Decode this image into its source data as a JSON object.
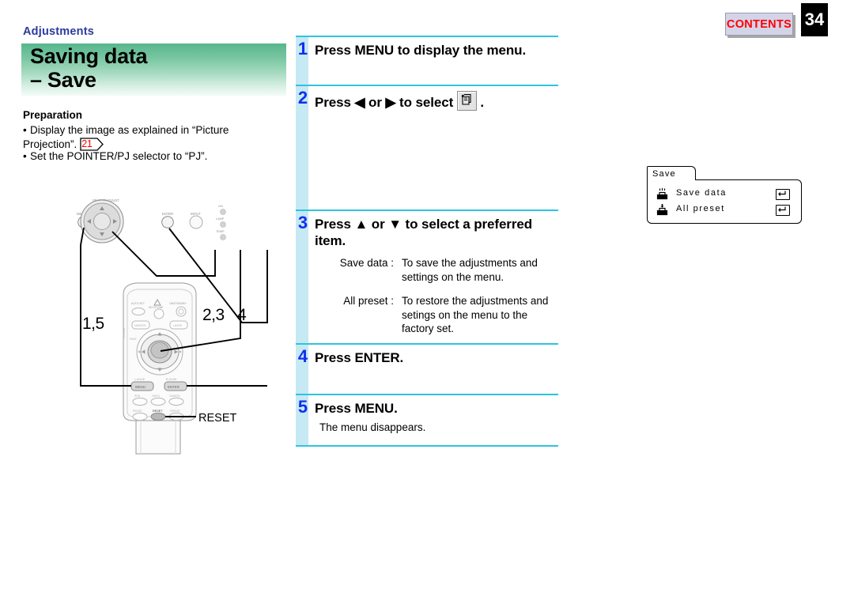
{
  "header": {
    "contents_label": "CONTENTS",
    "page_number": "34",
    "section_label": "Adjustments"
  },
  "title": {
    "line1": "Saving data",
    "line2": "– Save"
  },
  "preparation": {
    "heading": "Preparation",
    "items": [
      "Display the image as explained in “Picture Projection”.",
      "Set the POINTER/PJ selector to “PJ”."
    ],
    "page_ref": "21"
  },
  "steps": [
    {
      "number": "1",
      "heading": "Press MENU to display the menu."
    },
    {
      "number": "2",
      "heading_before": "Press ◀ or ▶ to select",
      "heading_after": ".",
      "icon": "save-menu-icon"
    },
    {
      "number": "3",
      "heading": "Press ▲ or ▼ to select a preferred item.",
      "definitions": [
        {
          "term": "Save data :",
          "desc": "To save the adjustments and settings on the menu."
        },
        {
          "term": "All preset :",
          "desc": "To restore the adjustments and setings on the menu to the factory set."
        }
      ]
    },
    {
      "number": "4",
      "heading": "Press ENTER."
    },
    {
      "number": "5",
      "heading": "Press MENU.",
      "note": "The menu disappears."
    }
  ],
  "osd_menu": {
    "tab_label": "Save",
    "rows": [
      {
        "label": "Save data",
        "icon": "save-data-icon",
        "action": "enter-return-icon"
      },
      {
        "label": "All preset",
        "icon": "all-preset-icon",
        "action": "enter-return-icon"
      }
    ]
  },
  "illustration": {
    "projector_panel": {
      "labels": [
        "ON/STANDBY",
        "MENU",
        "SELECT/ADJUST",
        "ENTER",
        "INPUT",
        "ON",
        "LAMP",
        "TEMP"
      ]
    },
    "remote": {
      "labels": [
        "AUTO SET",
        "KEYSTONE",
        "ON/STANDBY",
        "MARKER",
        "LASER",
        "VOLUME",
        "FREEZE",
        "L-CLICK",
        "MENU",
        "R-CLICK",
        "ENTER",
        "RGB",
        "VIDEO",
        "CAMERA",
        "RESIZE",
        "RESET",
        "FREEZE"
      ]
    },
    "callouts": [
      {
        "text": "1,5",
        "target": "menu-button"
      },
      {
        "text": "2,3",
        "target": "select-adjust-pad"
      },
      {
        "text": "4",
        "target": "enter-button"
      },
      {
        "text": "RESET",
        "target": "reset-button"
      }
    ]
  },
  "colors": {
    "accent_blue": "#1030ee",
    "rule_cyan": "#2ec4e0",
    "bar_cyan": "#c6e9f4",
    "banner_green": "#57b68c",
    "contents_red": "#ff0000",
    "section_blue": "#2b3a9e"
  }
}
